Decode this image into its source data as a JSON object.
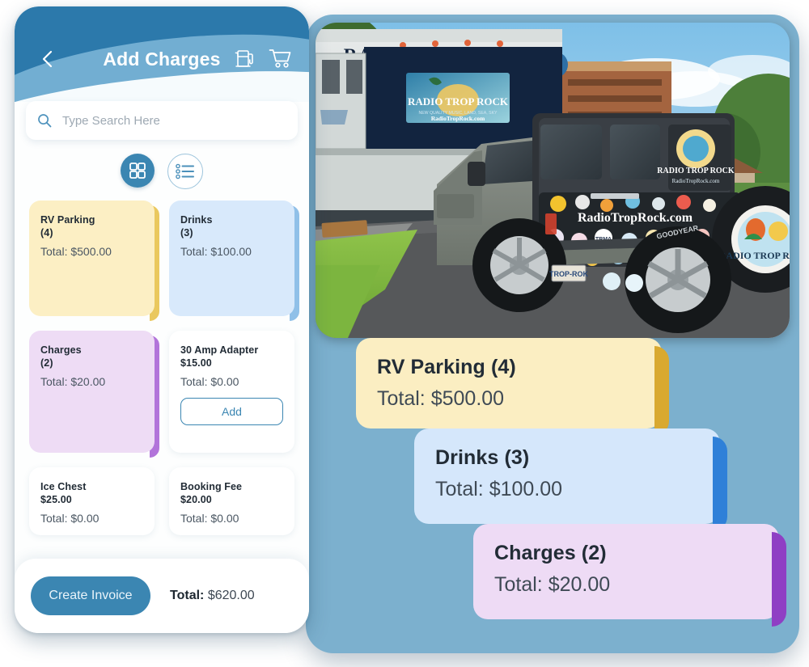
{
  "app": {
    "header": {
      "title": "Add Charges",
      "back_icon": "chevron-left-icon",
      "fuel_icon": "fuel-pump-icon",
      "cart_icon": "shopping-cart-icon"
    },
    "search": {
      "placeholder": "Type Search Here",
      "value": "",
      "icon": "search-icon"
    },
    "view_toggle": {
      "grid_icon": "grid-view-icon",
      "list_icon": "list-view-icon",
      "active": "grid"
    },
    "cards": [
      {
        "name": "RV Parking",
        "qty": "(4)",
        "total": "Total: $500.00",
        "bg": "#fcefc4",
        "edge": "#eac85e",
        "size": "tall",
        "has_add": false,
        "price": ""
      },
      {
        "name": "Drinks",
        "qty": "(3)",
        "total": "Total: $100.00",
        "bg": "#d8e9fb",
        "edge": "#90c0e8",
        "size": "tall",
        "has_add": false,
        "price": ""
      },
      {
        "name": "Charges",
        "qty": "(2)",
        "total": "Total: $20.00",
        "bg": "#eedcf5",
        "edge": "#b274da",
        "size": "mid",
        "has_add": false,
        "price": ""
      },
      {
        "name": "30 Amp Adapter",
        "qty": "",
        "total": "Total: $0.00",
        "bg": "#ffffff",
        "edge": "",
        "size": "mid",
        "has_add": true,
        "price": "$15.00",
        "add_label": "Add"
      },
      {
        "name": "Ice Chest",
        "qty": "",
        "total": "Total: $0.00",
        "bg": "#ffffff",
        "edge": "",
        "size": "short",
        "has_add": false,
        "price": "$25.00"
      },
      {
        "name": "Booking Fee",
        "qty": "",
        "total": "Total: $0.00",
        "bg": "#ffffff",
        "edge": "",
        "size": "short",
        "has_add": false,
        "price": "$20.00"
      }
    ],
    "footer": {
      "create_invoice_label": "Create Invoice",
      "total_label": "Total:",
      "total_value": "$620.00"
    }
  },
  "photo": {
    "alt": "Jeep Wrangler towing RV with Radio Trop Rock branding",
    "rv_banner_text": "RADIO TROP ROCK",
    "rv_sign_text": "RADIO TROP ROCK",
    "jeep_url_text": "RadioTropRock.com",
    "spare_tire_text": "RADIO TROP ROCK",
    "plate_text": "TROP-ROK"
  },
  "callouts": [
    {
      "name": "RV Parking (4)",
      "total": "Total: $500.00",
      "bg": "#fbeec2",
      "edge": "#d9a92f"
    },
    {
      "name": "Drinks (3)",
      "total": "Total: $100.00",
      "bg": "#d5e7fb",
      "edge": "#2f80d8"
    },
    {
      "name": "Charges (2)",
      "total": "Total: $20.00",
      "bg": "#eedbf5",
      "edge": "#8f3fc4"
    }
  ],
  "colors": {
    "header_dark": "#2c79ab",
    "header_light": "#72aed2",
    "accent": "#3b86b2",
    "frame_blue": "#7cb0ce"
  }
}
